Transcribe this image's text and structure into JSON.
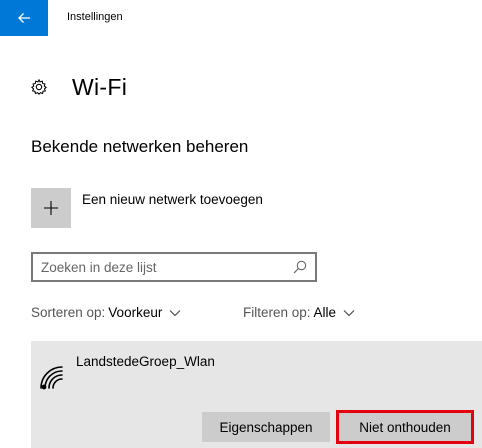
{
  "window": {
    "title": "Instellingen",
    "accent_color": "#0078d7"
  },
  "header": {
    "icon": "gear-icon",
    "title": "Wi-Fi"
  },
  "section": {
    "title": "Bekende netwerken beheren"
  },
  "add_network": {
    "label": "Een nieuw netwerk toevoegen"
  },
  "search": {
    "placeholder": "Zoeken in deze lijst"
  },
  "sort": {
    "label": "Sorteren op:",
    "value": "Voorkeur"
  },
  "filter": {
    "label": "Filteren op:",
    "value": "Alle"
  },
  "networks": [
    {
      "name": "LandstedeGroep_Wlan",
      "buttons": {
        "properties": "Eigenschappen",
        "forget": "Niet onthouden"
      },
      "highlight_color": "#e3000f"
    }
  ]
}
